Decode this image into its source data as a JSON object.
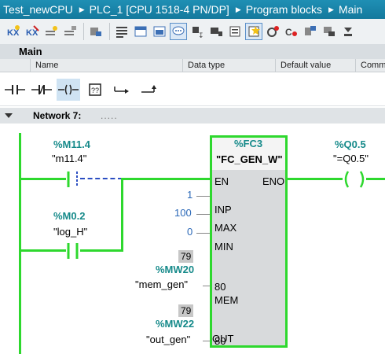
{
  "breadcrumb": [
    "Test_newCPU",
    "PLC_1 [CPU 1518-4 PN/DP]",
    "Program blocks",
    "Main"
  ],
  "toolbar": {
    "icons": [
      "monitor-all-icon",
      "monitor-off-icon",
      "insert-network-icon",
      "delete-network-icon",
      "go-online-icon",
      "block-interface-icon",
      "favorites-icon",
      "open-all-networks-icon",
      "comments-icon",
      "absolute-operands-icon",
      "symbolic-operands-icon",
      "list-icon",
      "favorites-edit-icon",
      "go-to-error-icon",
      "go-to-next-icon",
      "compare-icon",
      "download-icon",
      "settings-icon"
    ]
  },
  "interface": {
    "title": "Main",
    "columns": [
      "Name",
      "Data type",
      "Default value",
      "Comm"
    ]
  },
  "instructions": [
    "no-contact-icon",
    "nc-contact-icon",
    "coil-icon",
    "empty-box-icon",
    "open-branch-icon",
    "close-branch-icon"
  ],
  "network": {
    "label": "Network 7:",
    "comment": "....."
  },
  "ladder": {
    "contact1": {
      "address": "%M11.4",
      "symbol": "\"m11.4\""
    },
    "contact2": {
      "address": "%M0.2",
      "symbol": "\"log_H\""
    },
    "block": {
      "address": "%FC3",
      "name": "\"FC_GEN_W\"",
      "pins": {
        "en": "EN",
        "eno": "ENO",
        "inp": "INP",
        "max": "MAX",
        "min": "MIN",
        "mem": "MEM",
        "out": "OUT"
      },
      "inp_value": "1",
      "max_value": "100",
      "min_value": "0",
      "mem_monitor": "79",
      "mem_address": "%MW20",
      "mem_symbol": "\"mem_gen\"",
      "mem_inside_value": "80",
      "out_monitor": "79",
      "out_address": "%MW22",
      "out_symbol": "\"out_gen\"",
      "out_inside_value": "80"
    },
    "coil": {
      "address": "%Q0.5",
      "symbol": "\"=Q0.5\""
    }
  },
  "colors": {
    "power_flow": "#2ed82e",
    "address": "#168a8a",
    "header": "#1f8fb4",
    "constant": "#2c69b8"
  }
}
